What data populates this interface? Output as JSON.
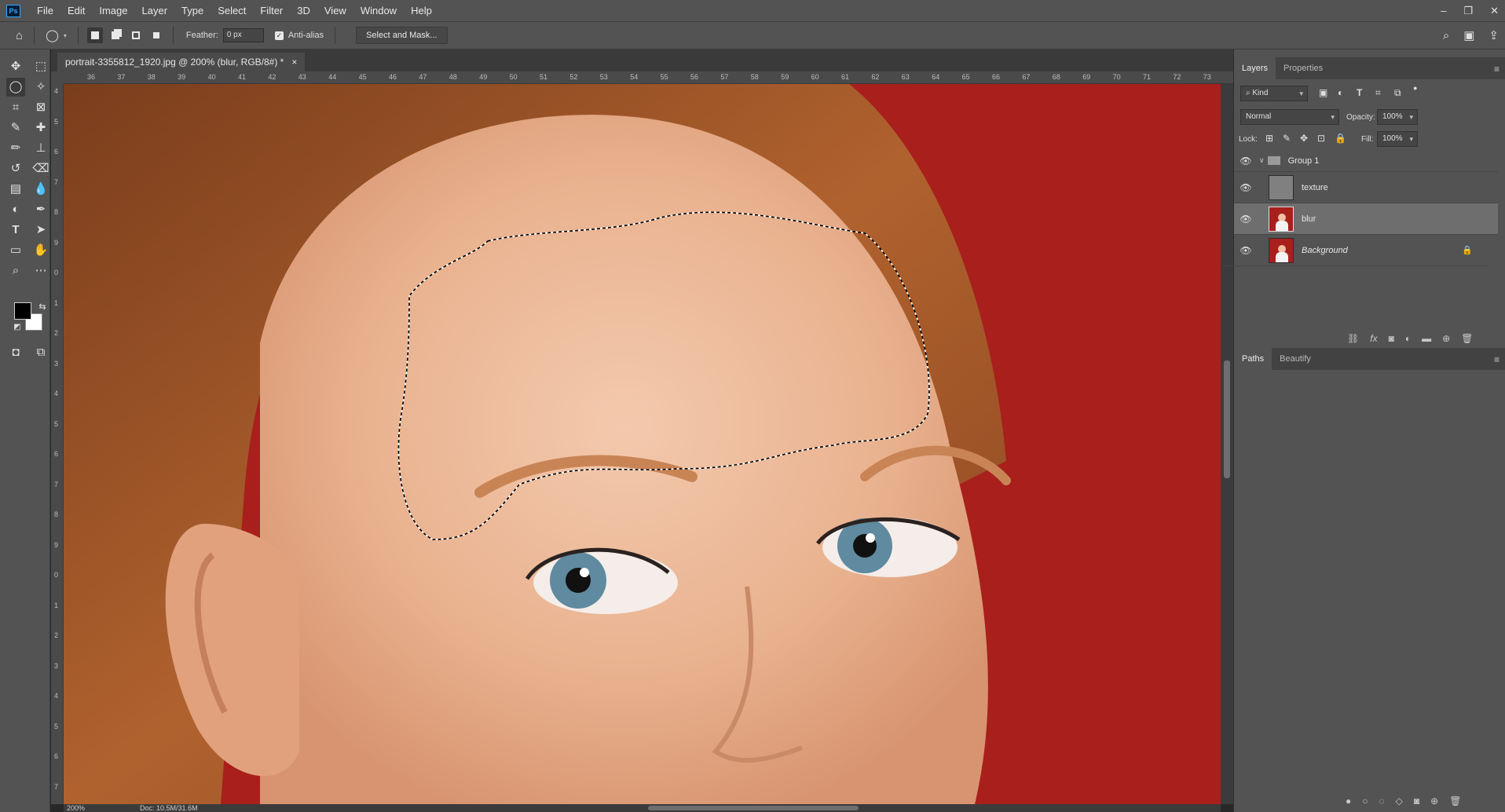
{
  "app": {
    "logo_text": "Ps"
  },
  "menu": [
    "File",
    "Edit",
    "Image",
    "Layer",
    "Type",
    "Select",
    "Filter",
    "3D",
    "View",
    "Window",
    "Help"
  ],
  "window_controls": {
    "minimize": "–",
    "restore": "❐",
    "close": "✕"
  },
  "options": {
    "feather_label": "Feather:",
    "feather_value": "0 px",
    "antialias_label": "Anti-alias",
    "antialias_checked": "✓",
    "select_mask_label": "Select and Mask..."
  },
  "document": {
    "tab_title": "portrait-3355812_1920.jpg @ 200% (blur, RGB/8#) *",
    "close_glyph": "×",
    "ruler_h_labels": [
      "36",
      "37",
      "38",
      "39",
      "40",
      "41",
      "42",
      "43",
      "44",
      "45",
      "46",
      "47",
      "48",
      "49",
      "50",
      "51",
      "52",
      "53",
      "54",
      "55",
      "56",
      "57",
      "58",
      "59",
      "60",
      "61",
      "62",
      "63",
      "64",
      "65",
      "66",
      "67",
      "68",
      "69",
      "70",
      "71",
      "72",
      "73"
    ],
    "ruler_v_labels": [
      "4",
      "5",
      "6",
      "7",
      "8",
      "9",
      "0",
      "1",
      "2",
      "3",
      "4",
      "5",
      "6",
      "7",
      "8",
      "9",
      "0",
      "1",
      "2",
      "3",
      "4",
      "5",
      "6",
      "7"
    ],
    "status_zoom": "200%",
    "status_doc": "Doc: 10.5M/31.6M"
  },
  "layers_panel": {
    "tabs": [
      "Layers",
      "Properties"
    ],
    "filter_kind": "Kind",
    "blend_mode": "Normal",
    "opacity_label": "Opacity:",
    "opacity_value": "100%",
    "lock_label": "Lock:",
    "fill_label": "Fill:",
    "fill_value": "100%",
    "layers": [
      {
        "name": "Group 1",
        "kind": "group"
      },
      {
        "name": "texture",
        "kind": "gray"
      },
      {
        "name": "blur",
        "kind": "photo",
        "selected": true
      },
      {
        "name": "Background",
        "kind": "photo",
        "locked": true
      }
    ]
  },
  "paths_panel": {
    "tabs": [
      "Paths",
      "Beautify"
    ]
  },
  "colors": {
    "accent": "#31a8ff",
    "canvas_red": "#a81f1c",
    "panel": "#535353"
  }
}
